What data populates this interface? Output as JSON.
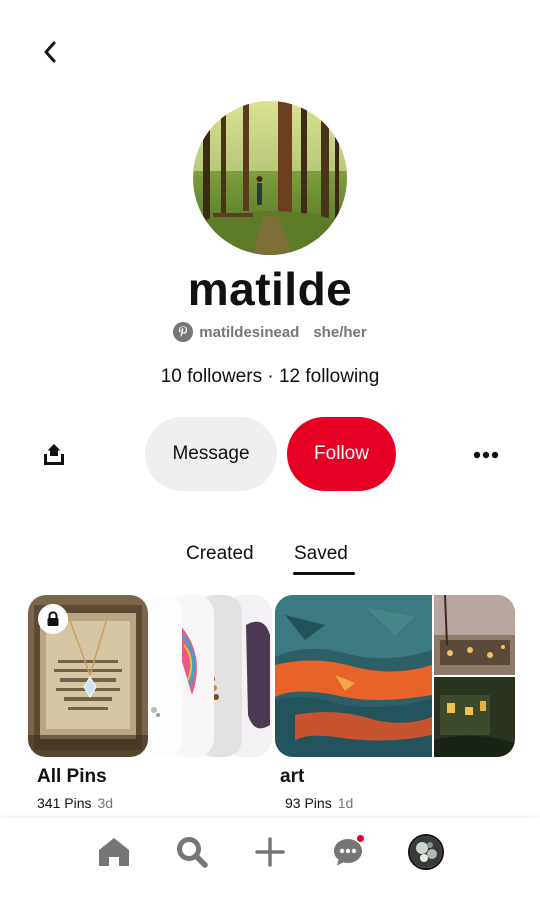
{
  "profile": {
    "display_name": "matilde",
    "username": "matildesinead",
    "pronouns": "she/her",
    "follow_stats": "10 followers · 12 following"
  },
  "actions": {
    "message_label": "Message",
    "follow_label": "Follow"
  },
  "tabs": [
    {
      "label": "Created",
      "active": false
    },
    {
      "label": "Saved",
      "active": true
    }
  ],
  "boards": [
    {
      "title": "All Pins",
      "pin_count": "341 Pins",
      "age": "3d",
      "secret": true
    },
    {
      "title": "art",
      "pin_count": "93 Pins",
      "age": "1d",
      "secret": false
    }
  ],
  "bottom_nav": {
    "items": [
      "home-icon",
      "search-icon",
      "plus-icon",
      "messages-icon",
      "profile-avatar"
    ],
    "messages_has_notification": true
  },
  "colors": {
    "accent": "#e60023",
    "secondary_button": "#efefef",
    "muted_text": "#767676"
  }
}
